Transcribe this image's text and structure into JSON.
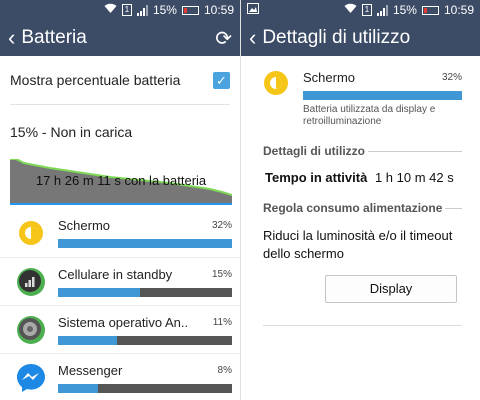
{
  "status_bar": {
    "battery_percent": "15%",
    "time": "10:59",
    "sim_label": "1"
  },
  "left": {
    "title": "Batteria",
    "show_percent": {
      "label": "Mostra percentuale batteria",
      "checked": true
    },
    "status": "15% - Non in carica",
    "graph": {
      "label": "17 h 26 m 11 s con la batteria"
    },
    "apps": [
      {
        "name": "Schermo",
        "percent": "32%",
        "fill": 1.0,
        "icon": "screen-brightness-icon"
      },
      {
        "name": "Cellulare in standby",
        "percent": "15%",
        "fill": 0.47,
        "icon": "cell-standby-icon"
      },
      {
        "name": "Sistema operativo An..",
        "percent": "11%",
        "fill": 0.34,
        "icon": "android-os-icon"
      },
      {
        "name": "Messenger",
        "percent": "8%",
        "fill": 0.23,
        "icon": "messenger-icon"
      }
    ]
  },
  "right": {
    "title": "Dettagli di utilizzo",
    "item": {
      "name": "Schermo",
      "percent": "32%",
      "fill": 1.0,
      "description": "Batteria utilizzata da display e retroilluminazione"
    },
    "details_header": "Dettagli di utilizzo",
    "active_time_label": "Tempo in attività",
    "active_time_value": "1 h 10 m 42 s",
    "power_header": "Regola consumo alimentazione",
    "advice": "Riduci la luminosità e/o il timeout dello schermo",
    "display_button": "Display"
  },
  "colors": {
    "appbar": "#3c4b66",
    "accent": "#3f97d6",
    "graph_line": "#7ed957"
  }
}
